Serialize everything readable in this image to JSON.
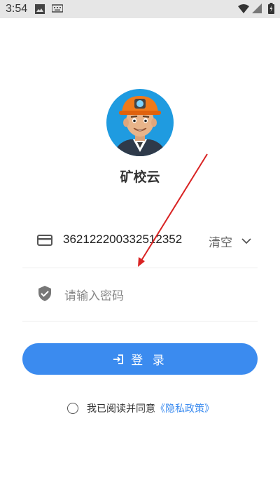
{
  "status_bar": {
    "time": "3:54",
    "icons": [
      "image-icon",
      "keyboard-icon",
      "wifi-icon",
      "signal-icon",
      "battery-icon"
    ]
  },
  "app": {
    "title": "矿校云"
  },
  "account": {
    "value": "362122200332512352",
    "clear_label": "清空"
  },
  "password": {
    "placeholder": "请输入密码"
  },
  "login": {
    "label": "登 录"
  },
  "agreement": {
    "text": "我已阅读并同意",
    "policy_link": "《隐私政策》"
  },
  "colors": {
    "accent": "#3b8bef",
    "avatar_bg": "#1f9be0",
    "annotation_arrow": "#d92323"
  }
}
